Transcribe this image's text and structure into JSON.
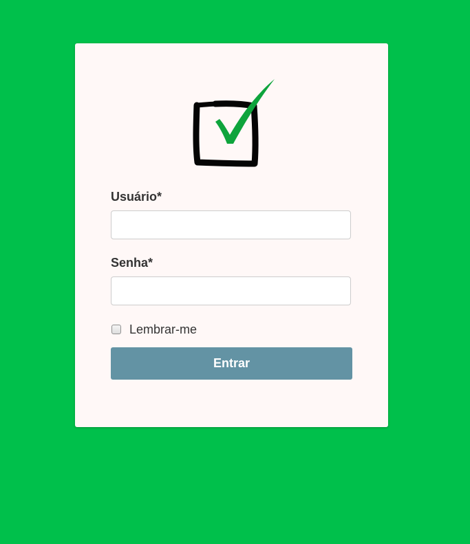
{
  "colors": {
    "background": "#00c04b",
    "card": "#fff8f7",
    "button": "#6393a4",
    "check": "#0ea43c"
  },
  "logo": {
    "icon": "checkbox-check-icon"
  },
  "form": {
    "username_label": "Usuário*",
    "username_value": "",
    "password_label": "Senha*",
    "password_value": "",
    "remember_label": "Lembrar-me",
    "remember_checked": false,
    "submit_label": "Entrar"
  }
}
